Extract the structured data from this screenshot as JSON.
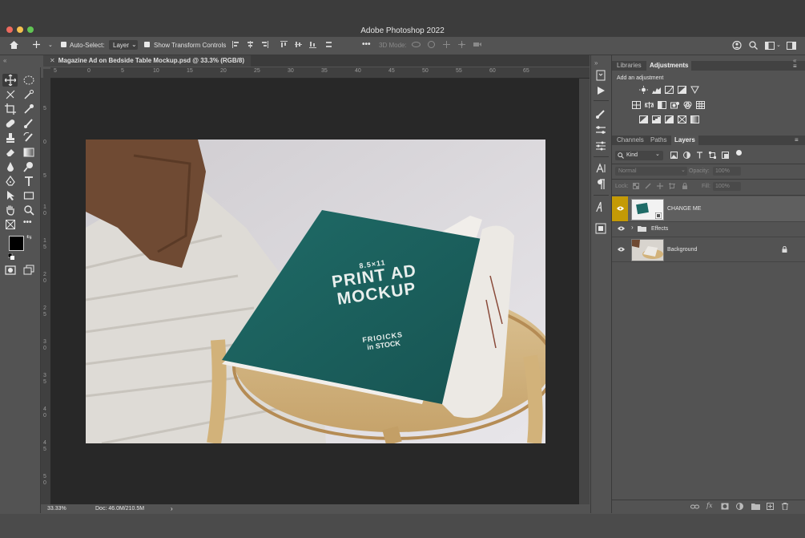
{
  "window": {
    "title": "Adobe Photoshop 2022"
  },
  "options_bar": {
    "auto_select_label": "Auto-Select:",
    "auto_select_value": "Layer",
    "show_transform_label": "Show Transform Controls",
    "three_d_mode_label": "3D Mode:",
    "more_label": "•••"
  },
  "document": {
    "tab_label": "Magazine Ad on Bedside Table Mockup.psd @ 33.3% (RGB/8)",
    "zoom": "33.33%",
    "doc_size": "Doc: 46.0M/210.5M",
    "status_arrow": "›"
  },
  "rulers": {
    "top": [
      "5",
      "0",
      "5",
      "10",
      "15",
      "20",
      "25",
      "30",
      "35",
      "40",
      "45",
      "50",
      "55",
      "60",
      "65"
    ],
    "left": [
      "5",
      "0",
      "5",
      "1 0",
      "1 5",
      "2 0",
      "2 5",
      "3 0",
      "3 5",
      "4 0",
      "4 5",
      "5 0"
    ]
  },
  "artwork": {
    "size_line": "8.5×11",
    "headline_1": "PRINT AD",
    "headline_2": "MOCKUP",
    "brand_1": "FRIOICKS",
    "brand_2": "in STOCK"
  },
  "panels": {
    "top_tabs": [
      "Libraries",
      "Adjustments"
    ],
    "adjustments_hint": "Add an adjustment",
    "layer_tabs": [
      "Channels",
      "Paths",
      "Layers"
    ],
    "kind_label": "Kind",
    "blend_mode": "Normal",
    "opacity_label": "Opacity:",
    "opacity_value": "100%",
    "lock_label": "Lock:",
    "fill_label": "Fill:",
    "fill_value": "100%"
  },
  "layers": [
    {
      "name": "CHANGE ME",
      "selected": true
    },
    {
      "name": "Effects",
      "group": true
    },
    {
      "name": "Background",
      "locked": true
    }
  ],
  "colors": {
    "accent": "#c49a05",
    "magazine": "#1b5e5b",
    "canvas_bg": "#282828"
  }
}
